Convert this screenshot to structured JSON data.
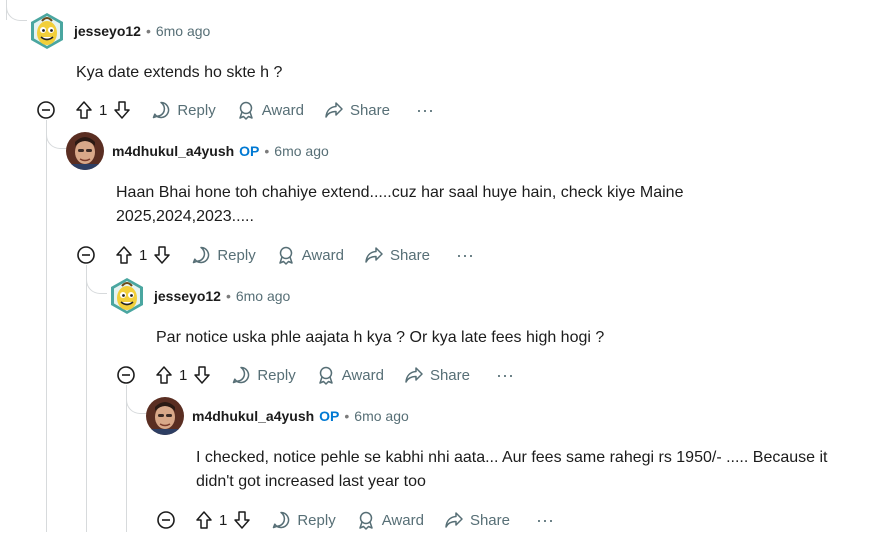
{
  "comments": [
    {
      "username": "jesseyo12",
      "op": "",
      "time": "6mo ago",
      "text": "Kya date extends ho skte h ?",
      "votes": "1",
      "avatar": "snoo-banana-icon"
    },
    {
      "username": "m4dhukul_a4yush",
      "op": "OP",
      "time": "6mo ago",
      "text": "Haan Bhai hone toh chahiye extend.....cuz har saal huye hain, check kiye Maine 2025,2024,2023.....",
      "votes": "1",
      "avatar": "photo-avatar"
    },
    {
      "username": "jesseyo12",
      "op": "",
      "time": "6mo ago",
      "text": "Par notice uska phle aajata h kya ? Or kya late fees high hogi ?",
      "votes": "1",
      "avatar": "snoo-banana-icon"
    },
    {
      "username": "m4dhukul_a4yush",
      "op": "OP",
      "time": "6mo ago",
      "text": "I checked, notice pehle se kabhi nhi aata... Aur fees same rahegi rs 1950/- ..... Because it didn't got increased last year too",
      "votes": "1",
      "avatar": "photo-avatar"
    }
  ],
  "actions": {
    "reply": "Reply",
    "award": "Award",
    "share": "Share",
    "more": "···"
  },
  "separator": "•",
  "colors": {
    "op_blue": "#0079d3",
    "meta_gray": "#576f76",
    "thread_line": "#d7dadc"
  }
}
